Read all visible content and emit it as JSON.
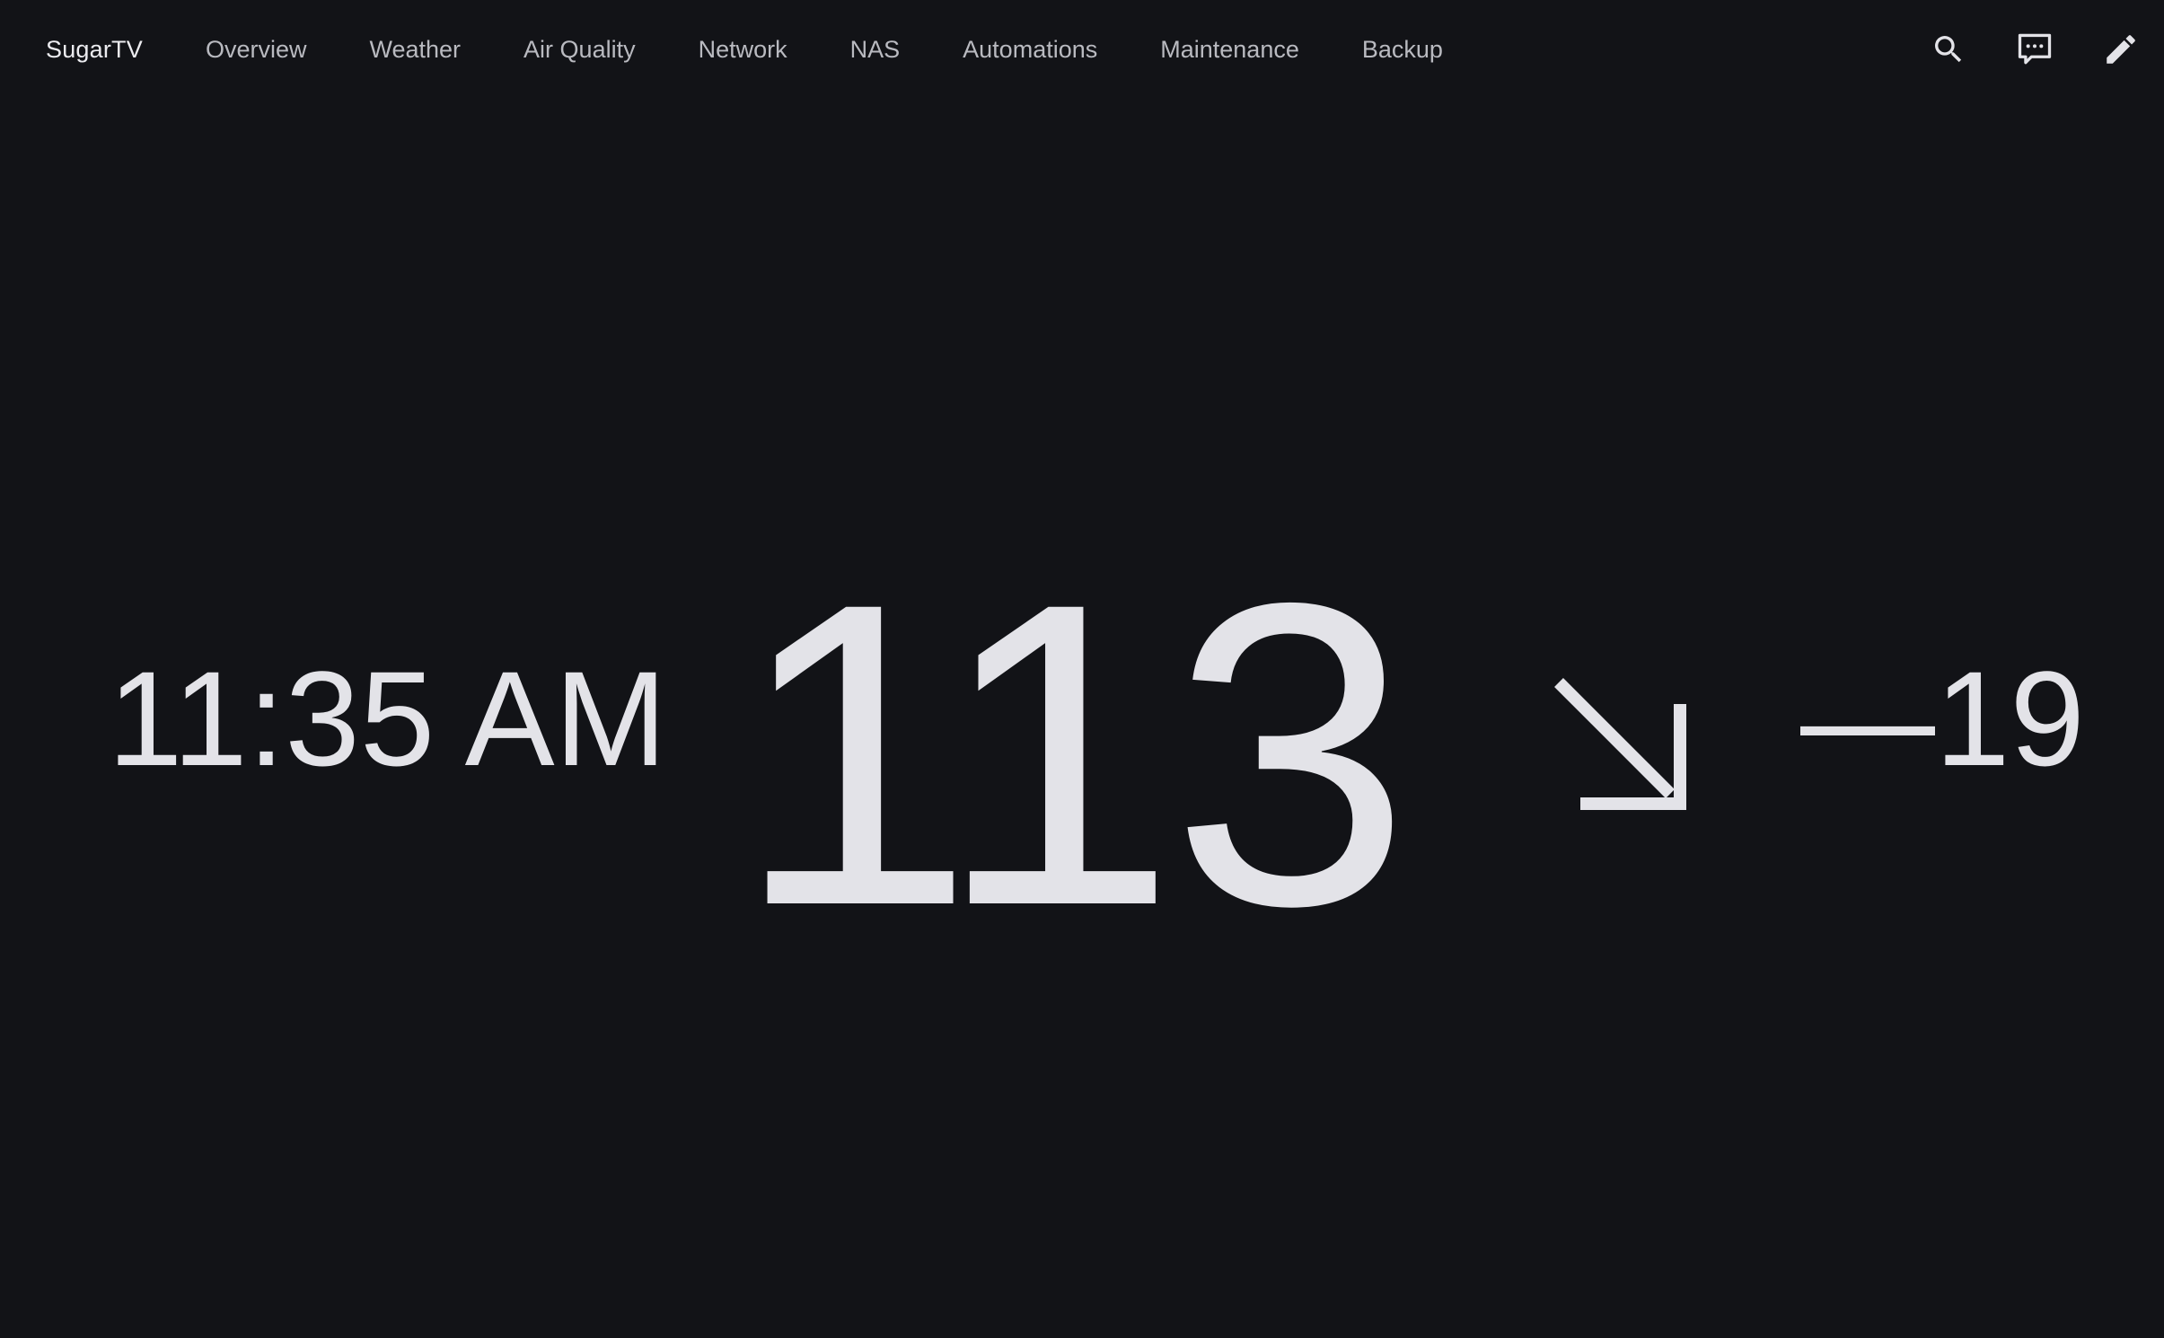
{
  "app": {
    "brand": "SugarTV"
  },
  "nav": {
    "tabs": [
      {
        "label": "Overview"
      },
      {
        "label": "Weather"
      },
      {
        "label": "Air Quality"
      },
      {
        "label": "Network"
      },
      {
        "label": "NAS"
      },
      {
        "label": "Automations"
      },
      {
        "label": "Maintenance"
      },
      {
        "label": "Backup"
      }
    ]
  },
  "actions": {
    "search_icon": "search-icon",
    "chat_icon": "chat-icon",
    "edit_icon": "pencil-icon"
  },
  "reading": {
    "time": "11:35 AM",
    "value": "113",
    "trend_icon": "arrow-down-right-icon",
    "delta": "—19"
  },
  "colors": {
    "background": "#121317",
    "text": "#e3e3e8",
    "tab_text": "#b9bac0"
  }
}
